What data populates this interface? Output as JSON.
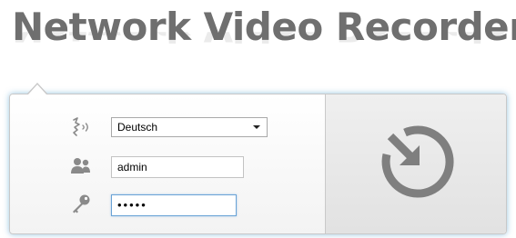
{
  "header": {
    "title": "Network Video Recorder"
  },
  "login": {
    "language_selected": "Deutsch",
    "username_value": "admin",
    "password_masked": "•••••"
  },
  "icons": {
    "language": "speech-language-icon",
    "user": "users-icon",
    "password": "key-icon",
    "login": "login-arrow-icon"
  },
  "colors": {
    "title": "#6f6f6f",
    "panel_glow": "#4696c8",
    "icon_gray": "#8a8a8a"
  }
}
